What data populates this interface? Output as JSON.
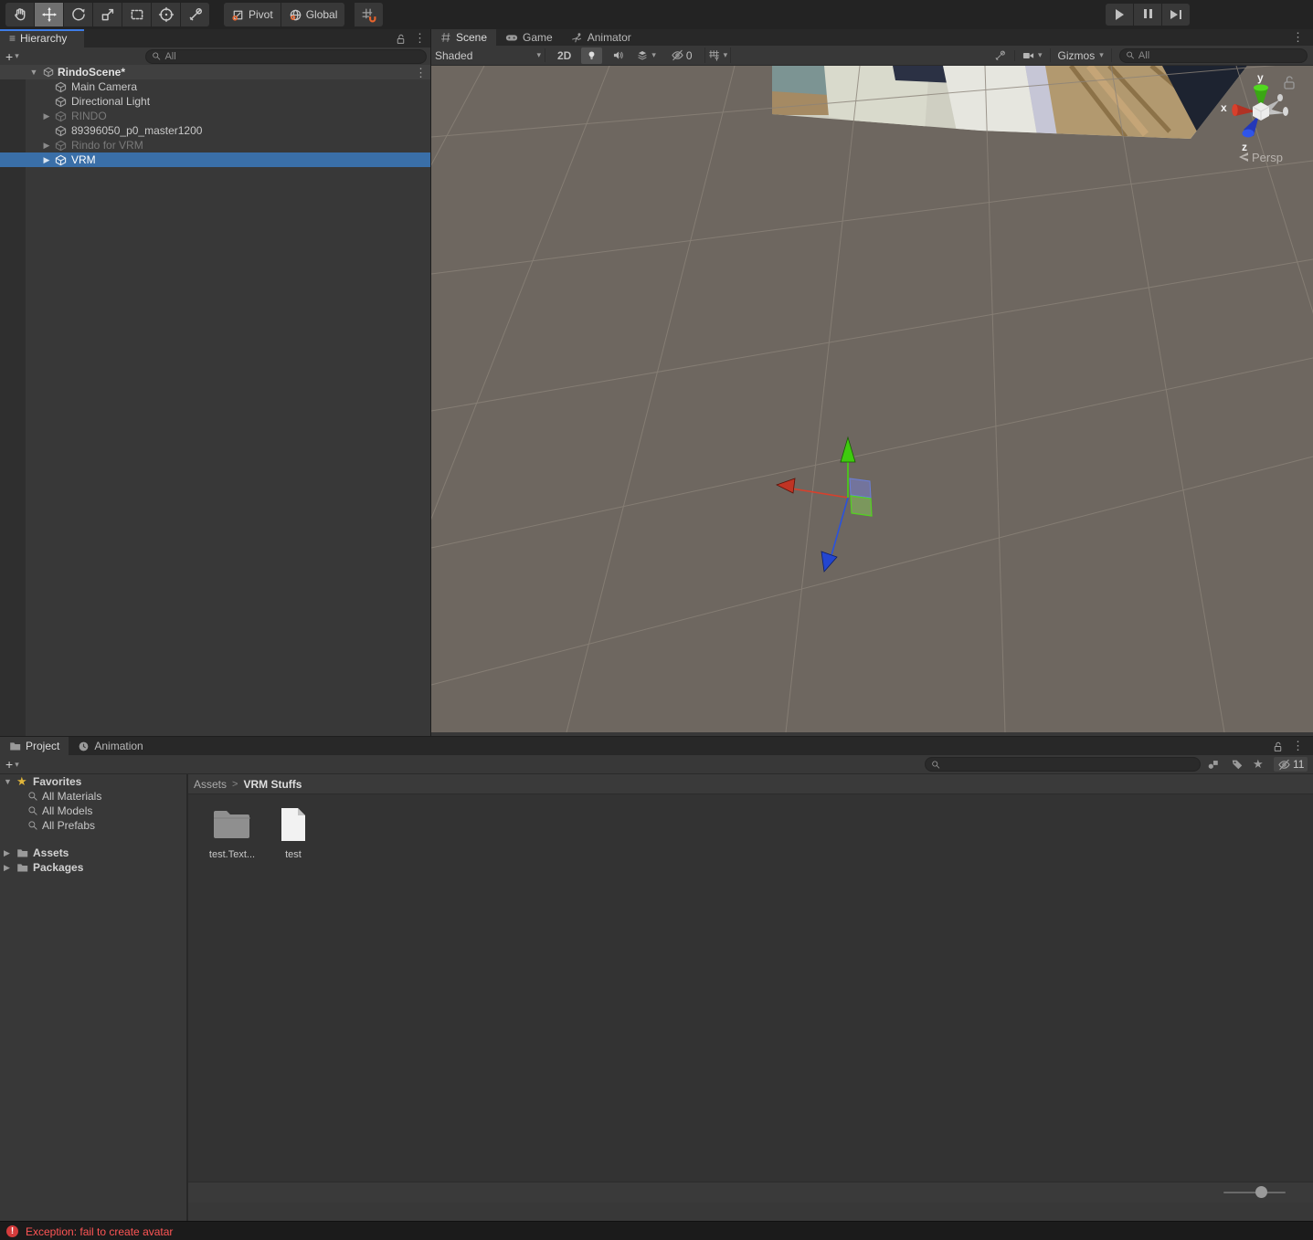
{
  "colors": {
    "accent_blue": "#3e7de7",
    "selection_blue": "#3a6fa8",
    "orange_accent": "#e8642d",
    "error_red": "#ff5555",
    "scene_background": "#6e6760",
    "axis_x_red": "#d8402c",
    "axis_y_green": "#47d413",
    "axis_z_blue": "#2a52dd"
  },
  "glyphs": {
    "menu_dots": "⋮",
    "dropdown_arrow": "▾",
    "expander_collapsed": "▶",
    "expander_expanded": "▼",
    "breadcrumb_separator": ">",
    "plus": "+",
    "hierarchy_menu": "≡",
    "star": "★"
  },
  "topbar": {
    "pivot_label": "Pivot",
    "global_label": "Global"
  },
  "hierarchy": {
    "tab_label": "Hierarchy",
    "search_placeholder": "All",
    "scene_name": "RindoScene*",
    "items": [
      {
        "label": "Main Camera"
      },
      {
        "label": "Directional Light"
      },
      {
        "label": "RINDO"
      },
      {
        "label": "89396050_p0_master1200"
      },
      {
        "label": "Rindo for VRM"
      },
      {
        "label": "VRM"
      }
    ]
  },
  "scene": {
    "tab_scene": "Scene",
    "tab_game": "Game",
    "tab_animator": "Animator",
    "shading_mode": "Shaded",
    "mode_2d": "2D",
    "hidden_count": "0",
    "gizmos_label": "Gizmos",
    "search_placeholder": "All",
    "axis_x": "x",
    "axis_y": "y",
    "axis_z": "z",
    "projection_label": "Persp"
  },
  "project": {
    "tab_project": "Project",
    "tab_animation": "Animation",
    "favorites_label": "Favorites",
    "favorites_items": [
      {
        "label": "All Materials"
      },
      {
        "label": "All Models"
      },
      {
        "label": "All Prefabs"
      }
    ],
    "folders": [
      {
        "label": "Assets"
      },
      {
        "label": "Packages"
      }
    ],
    "breadcrumb_root": "Assets",
    "breadcrumb_current": "VRM Stuffs",
    "assets": [
      {
        "name": "test.Text...",
        "type": "folder"
      },
      {
        "name": "test",
        "type": "file"
      }
    ],
    "hidden_count": "11"
  },
  "status": {
    "error_message": "Exception: fail to create avatar"
  }
}
